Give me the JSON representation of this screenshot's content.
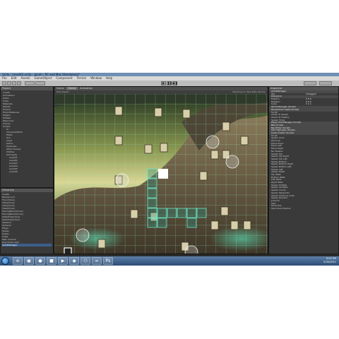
{
  "window": {
    "title": "Unity - Level02.unity - gaiah - PC and Mac Standalone*"
  },
  "menu": [
    "File",
    "Edit",
    "Assets",
    "GameObject",
    "Component",
    "Terrain",
    "Window",
    "Help"
  ],
  "toolbar": {
    "play_icon": "play-icon",
    "pause_icon": "pause-icon",
    "step_icon": "step-icon"
  },
  "hierarchy": {
    "tab": "Project",
    "items": [
      "Create",
      "Animations",
      "Editor",
      "Fonts",
      "Materials",
      "Models",
      "Physics",
      "PhysicMaterials",
      "Plugins",
      "Prefabs",
      "Resources",
      "Scenes",
      "Scripts",
      "AI",
      "CharacterMotor",
      "Editor",
      "GUI",
      "Level",
      "Game",
      "Powerups",
      "Other Scenes",
      "Utilities",
      "Gameplay",
      "Level01",
      "Level02",
      "Level03",
      "Level04",
      "Level05",
      "Level06"
    ]
  },
  "hierarchy2": {
    "tab": "Hierarchy",
    "items": [
      "Create",
      "Background",
      "Floor(Clone)",
      "Tiles(Clone)",
      "Tiles(Clone)",
      "Tiles(Clone)",
      "MovingBlock(Clone)",
      "MovingBlock(Clone)",
      "SpikeTrap(Clone)",
      "SpikeTrap(Clone)",
      "Spawner",
      "Spawner",
      "Player",
      "Spikes",
      "Spikes",
      "Crate",
      "Main Camera",
      "Directional light",
      "worldManager"
    ],
    "selected": "worldManager"
  },
  "scene": {
    "tabs": [
      "Scene",
      "Game",
      "Animation"
    ],
    "active_tab": "Game",
    "bar_left": "Free Aspect",
    "bar_right": "Maximize on Play   Stats   Gizmos"
  },
  "inspector": {
    "tab": "Inspector",
    "object": "worldManager",
    "rows": [
      {
        "label": "Tag",
        "value": "Untagged",
        "comp": false
      },
      {
        "label": "Transform",
        "value": "",
        "comp": true
      },
      {
        "label": "Position",
        "value": "0  0  0",
        "comp": false
      },
      {
        "label": "Rotation",
        "value": "0  0  0",
        "comp": false
      },
      {
        "label": "Scale",
        "value": "1  1  1",
        "comp": false
      },
      {
        "label": "World Manager (Script)",
        "value": "",
        "comp": true
      },
      {
        "label": "Randomizer Alpha (Script)",
        "value": "",
        "comp": true
      },
      {
        "label": "Script",
        "value": "",
        "comp": false
      },
      {
        "label": "Check To Spawn",
        "value": "",
        "comp": false
      },
      {
        "label": "Check To Destroy",
        "value": "",
        "comp": false
      },
      {
        "label": "Spawn Timer",
        "value": "",
        "comp": false
      },
      {
        "label": "Player Pref Manager (Script)",
        "value": "",
        "comp": true
      },
      {
        "label": "BGI (Script)",
        "value": "",
        "comp": true
      },
      {
        "label": "Bgi Writer (Script)",
        "value": "",
        "comp": true
      },
      {
        "label": "Grid Fileloader (Script)",
        "value": "",
        "comp": true
      },
      {
        "label": "Level Creator (Script)",
        "value": "",
        "comp": true
      },
      {
        "label": "Script",
        "value": "",
        "comp": false
      },
      {
        "label": "Spawn Color",
        "value": "",
        "comp": false
      },
      {
        "label": "Move Up",
        "value": "",
        "comp": false
      },
      {
        "label": "Move Down",
        "value": "",
        "comp": false
      },
      {
        "label": "Move Left",
        "value": "",
        "comp": false
      },
      {
        "label": "Move Right",
        "value": "",
        "comp": false
      },
      {
        "label": "No Spawns",
        "value": "",
        "comp": false
      },
      {
        "label": "Spawn Top",
        "value": "",
        "comp": false
      },
      {
        "label": "Spawn Top Right",
        "value": "",
        "comp": false
      },
      {
        "label": "Spawn Top Left",
        "value": "",
        "comp": false
      },
      {
        "label": "Spawn Bottom",
        "value": "",
        "comp": false
      },
      {
        "label": "Spawn Bottom Right",
        "value": "",
        "comp": false
      },
      {
        "label": "Spawn Bottom Left",
        "value": "",
        "comp": false
      },
      {
        "label": "Spawn Left",
        "value": "",
        "comp": false
      },
      {
        "label": "Spawn Right",
        "value": "",
        "comp": false
      },
      {
        "label": "Top Walls",
        "value": "",
        "comp": false
      },
      {
        "label": "Bottom Walls",
        "value": "",
        "comp": false
      },
      {
        "label": "Left Walls",
        "value": "",
        "comp": false
      },
      {
        "label": "Right Walls",
        "value": "",
        "comp": false
      },
      {
        "label": "Spawn Prefabs",
        "value": "",
        "comp": false
      },
      {
        "label": "Spawn All Walls",
        "value": "",
        "comp": false
      },
      {
        "label": "Spawn Corner",
        "value": "",
        "comp": false
      },
      {
        "label": "Spawn Teleporter",
        "value": "",
        "comp": false
      },
      {
        "label": "Spawn Pressure Cube",
        "value": "",
        "comp": false
      },
      {
        "label": "Spawn Random",
        "value": "",
        "comp": false
      },
      {
        "label": "Jump To",
        "value": "",
        "comp": false
      },
      {
        "label": "Size",
        "value": "",
        "comp": false
      },
      {
        "label": "Finish Pos",
        "value": "",
        "comp": false
      },
      {
        "label": "Size Check Radius",
        "value": "",
        "comp": false
      }
    ]
  },
  "taskbar": {
    "time": "9:05 PM",
    "date": "5/30/2011",
    "apps": [
      "ie-icon",
      "explorer-icon",
      "firefox-icon",
      "folder-icon",
      "media-icon",
      "chrome-icon",
      "unity-icon",
      "vs-icon",
      "photoshop-icon"
    ]
  },
  "colors": {
    "grid": "#8fe0b5",
    "editor_bg": "#2b2b2b",
    "selection": "#3c5f8c",
    "taskbar": "#2c4c74"
  }
}
